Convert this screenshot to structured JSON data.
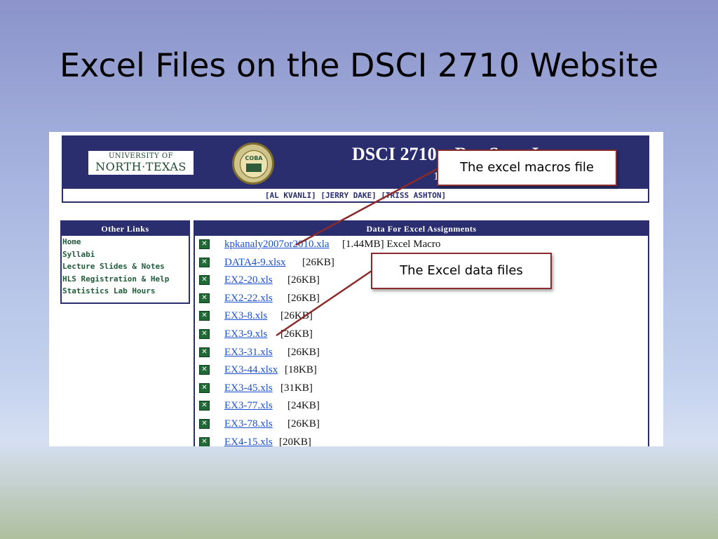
{
  "slide": {
    "title": "Excel Files on the DSCI 2710 Website"
  },
  "website": {
    "logo_left": {
      "line1": "UNIVERSITY OF",
      "line2": "NORTH·TEXAS"
    },
    "logo_seal": {
      "text": "COBA"
    },
    "course_title": "DSCI 2710 – Bus Stats I",
    "course_subtitle": "1",
    "instructors": "[AL KVANLI] [JERRY DAKE] [TRISS ASHTON]",
    "sidebar": {
      "heading": "Other Links",
      "links": [
        "Home",
        "Syllabi",
        "Lecture Slides & Notes",
        "HLS Registration & Help",
        "Statistics Lab Hours"
      ]
    },
    "main": {
      "heading": "Data For Excel Assignments",
      "files": [
        {
          "name": "kpkanaly2007or2010.xla",
          "size": "[1.44MB] Excel Macro"
        },
        {
          "name": "DATA4-9.xlsx",
          "size": "[26KB]"
        },
        {
          "name": "EX2-20.xls",
          "size": "[26KB]"
        },
        {
          "name": "EX2-22.xls",
          "size": "[26KB]"
        },
        {
          "name": "EX3-8.xls",
          "size": "[26KB]"
        },
        {
          "name": "EX3-9.xls",
          "size": "[26KB]"
        },
        {
          "name": "EX3-31.xls",
          "size": "[26KB]"
        },
        {
          "name": "EX3-44.xlsx",
          "size": "[18KB]"
        },
        {
          "name": "EX3-45.xls",
          "size": "[31KB]"
        },
        {
          "name": "EX3-77.xls",
          "size": "[24KB]"
        },
        {
          "name": "EX3-78.xls",
          "size": "[26KB]"
        },
        {
          "name": "EX4-15.xls",
          "size": "[20KB]"
        }
      ]
    }
  },
  "callouts": {
    "macros": "The excel macros file",
    "data": "The Excel data files"
  },
  "colors": {
    "site_navy": "#2a2e6e",
    "link_blue": "#1a4fd0",
    "sidebar_green": "#1e5c3a",
    "callout_border": "#8b2a2a",
    "arrow": "#8b2a2a"
  }
}
